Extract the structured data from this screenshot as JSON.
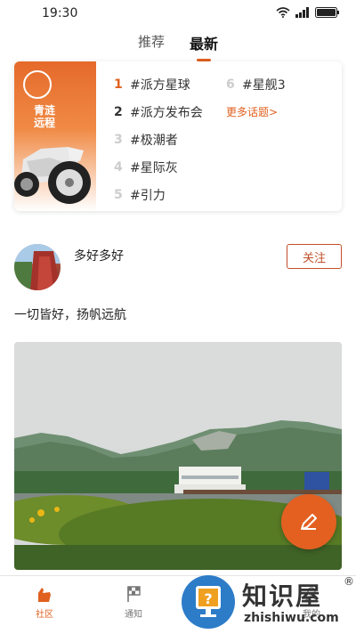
{
  "status": {
    "time": "19:30"
  },
  "tabs": [
    {
      "label": "推荐",
      "active": false
    },
    {
      "label": "最新",
      "active": true
    }
  ],
  "topics": {
    "banner_text_line1": "青涟",
    "banner_text_line2": "远程",
    "left": [
      {
        "rank": "1",
        "label": "#派方星球"
      },
      {
        "rank": "2",
        "label": "#派方发布会"
      },
      {
        "rank": "3",
        "label": "#极潮者"
      },
      {
        "rank": "4",
        "label": "#星际灰"
      },
      {
        "rank": "5",
        "label": "#引力"
      }
    ],
    "right": [
      {
        "rank": "6",
        "label": "#星舰3"
      }
    ],
    "more_label": "更多话题>"
  },
  "post": {
    "username": "多好多好",
    "follow_label": "关注",
    "text": "一切皆好，扬帆远航"
  },
  "bottom_nav": [
    {
      "label": "社区",
      "active": true,
      "icon": "hand-icon"
    },
    {
      "label": "通知",
      "active": false,
      "icon": "flag-icon"
    },
    {
      "label": "",
      "active": false,
      "icon": "shop-icon"
    },
    {
      "label": "我的",
      "active": false,
      "icon": "user-icon"
    }
  ],
  "watermark": {
    "title": "知识屋",
    "registered": "®",
    "subtitle": "zhishiwu.com"
  },
  "colors": {
    "accent": "#e0601f",
    "follow": "#c0502a"
  }
}
